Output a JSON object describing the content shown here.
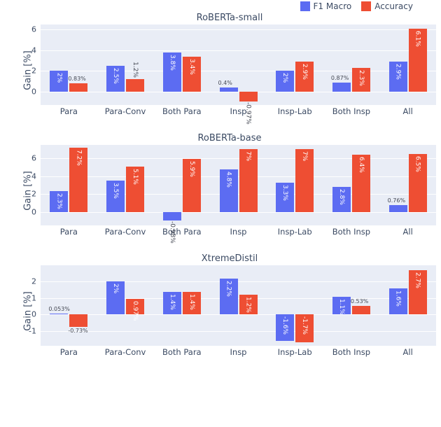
{
  "legend": {
    "items": [
      {
        "label": "F1 Macro",
        "color": "#5c6cf2"
      },
      {
        "label": "Accuracy",
        "color": "#ee4e33"
      }
    ]
  },
  "ylabel": "Gain [%]",
  "categories": [
    "Para",
    "Para-Conv",
    "Both Para",
    "Insp",
    "Insp-Lab",
    "Both Insp",
    "All"
  ],
  "chart_data": [
    {
      "title": "RoBERTa-small",
      "type": "bar",
      "ylim": [
        -1.3,
        6.5
      ],
      "yticks": [
        0,
        2,
        4,
        6
      ],
      "xlabel": "",
      "ylabel": "Gain [%]",
      "categories": [
        "Para",
        "Para-Conv",
        "Both Para",
        "Insp",
        "Insp-Lab",
        "Both Insp",
        "All"
      ],
      "series": [
        {
          "name": "F1 Macro",
          "color": "#5c6cf2",
          "values": [
            2.0,
            2.5,
            3.8,
            0.4,
            2.0,
            0.87,
            2.9
          ],
          "labels": [
            "2%",
            "2.5%",
            "3.8%",
            "0.4%",
            "2%",
            "0.87%",
            "2.9%"
          ]
        },
        {
          "name": "Accuracy",
          "color": "#ee4e33",
          "values": [
            0.83,
            1.2,
            3.4,
            -0.97,
            2.9,
            2.3,
            6.1
          ],
          "labels": [
            "0.83%",
            "1.2%",
            "3.4%",
            "-0.97%",
            "2.9%",
            "2.3%",
            "6.1%"
          ]
        }
      ]
    },
    {
      "title": "RoBERTa-base",
      "type": "bar",
      "ylim": [
        -1.5,
        7.5
      ],
      "yticks": [
        0,
        2,
        4,
        6
      ],
      "xlabel": "",
      "ylabel": "Gain [%]",
      "categories": [
        "Para",
        "Para-Conv",
        "Both Para",
        "Insp",
        "Insp-Lab",
        "Both Insp",
        "All"
      ],
      "series": [
        {
          "name": "F1 Macro",
          "color": "#5c6cf2",
          "values": [
            2.3,
            3.5,
            -0.98,
            4.8,
            3.3,
            2.8,
            0.76
          ],
          "labels": [
            "2.3%",
            "3.5%",
            "-0.98%",
            "4.8%",
            "3.3%",
            "2.8%",
            "0.76%"
          ]
        },
        {
          "name": "Accuracy",
          "color": "#ee4e33",
          "values": [
            7.2,
            5.1,
            5.9,
            7.0,
            7.0,
            6.4,
            6.5
          ],
          "labels": [
            "7.2%",
            "5.1%",
            "5.9%",
            "7%",
            "7%",
            "6.4%",
            "6.5%"
          ]
        }
      ]
    },
    {
      "title": "XtremeDistil",
      "type": "bar",
      "ylim": [
        -1.9,
        3.0
      ],
      "yticks": [
        -1,
        0,
        1,
        2
      ],
      "xlabel": "",
      "ylabel": "Gain [%]",
      "categories": [
        "Para",
        "Para-Conv",
        "Both Para",
        "Insp",
        "Insp-Lab",
        "Both Insp",
        "All"
      ],
      "series": [
        {
          "name": "F1 Macro",
          "color": "#5c6cf2",
          "values": [
            0.053,
            2.0,
            1.4,
            2.2,
            -1.6,
            1.1,
            1.6
          ],
          "labels": [
            "0.053%",
            "2%",
            "1.4%",
            "2.2%",
            "-1.6%",
            "1.1%",
            "1.6%"
          ]
        },
        {
          "name": "Accuracy",
          "color": "#ee4e33",
          "values": [
            -0.73,
            0.97,
            1.4,
            1.2,
            -1.7,
            0.53,
            2.7
          ],
          "labels": [
            "-0.73%",
            "0.97%",
            "1.4%",
            "1.2%",
            "-1.7%",
            "0.53%",
            "2.7%"
          ]
        }
      ]
    }
  ]
}
